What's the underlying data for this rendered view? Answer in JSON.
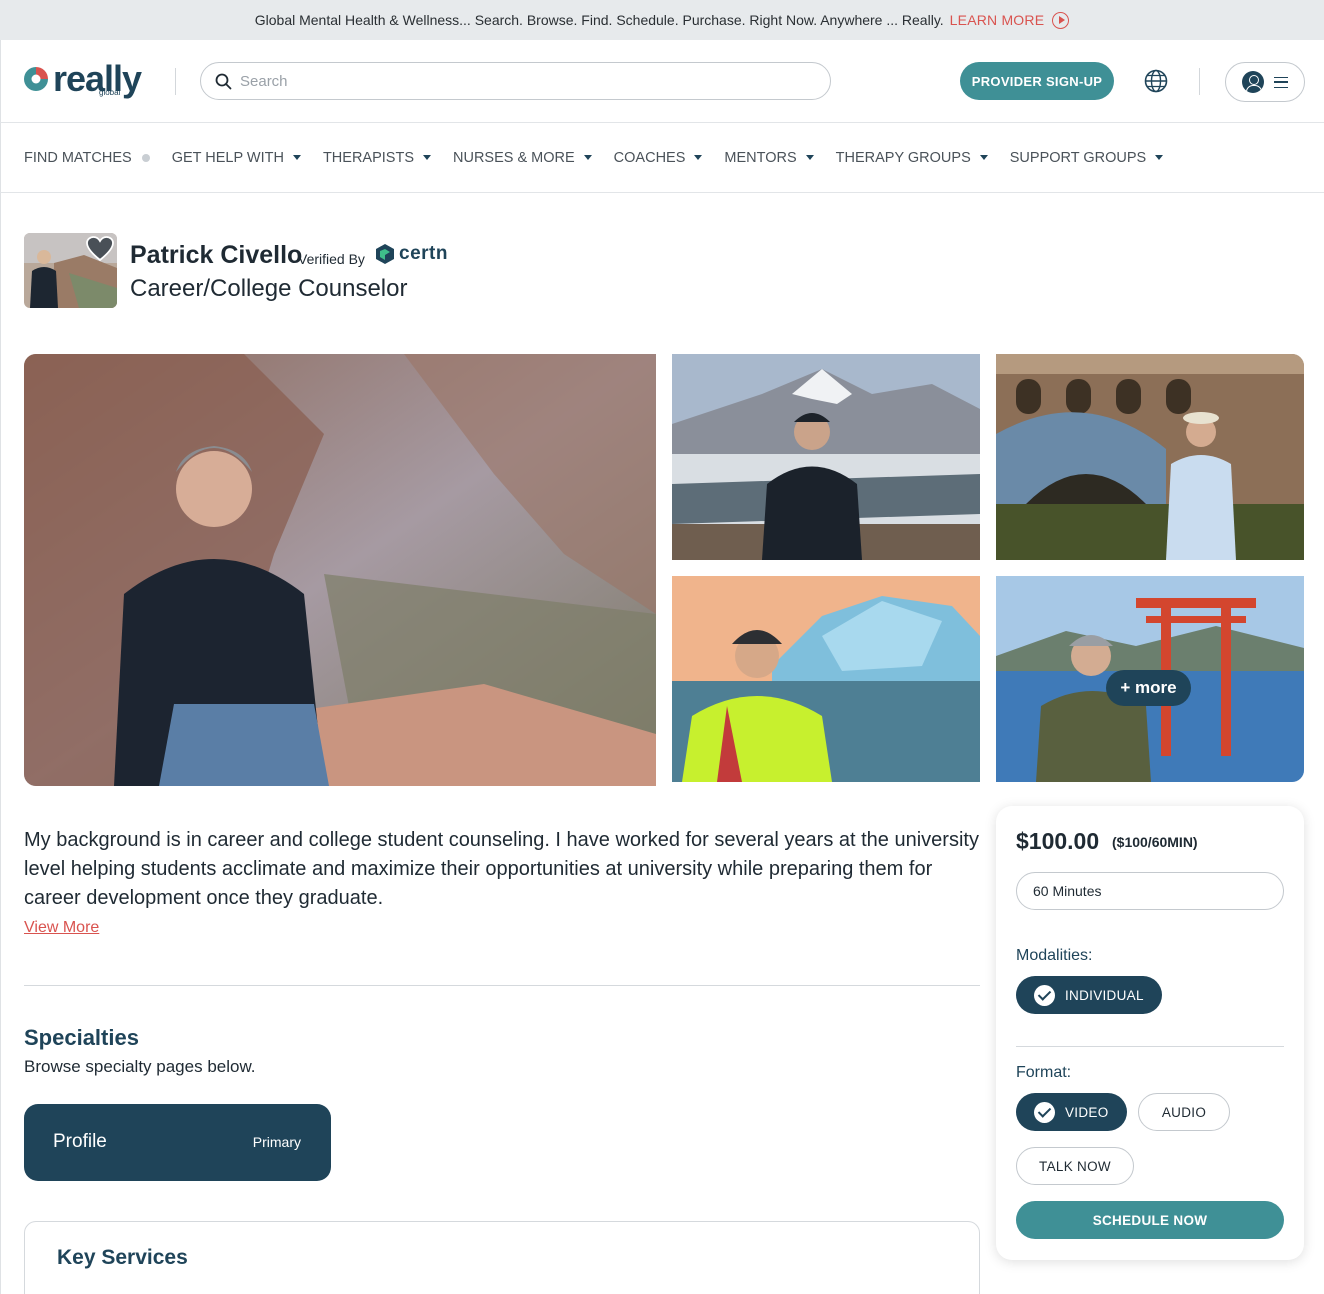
{
  "banner": {
    "text": "Global Mental Health & Wellness... Search. Browse. Find. Schedule. Purchase. Right Now. Anywhere ... Really.",
    "link": "LEARN MORE"
  },
  "header": {
    "logo_word": "really",
    "logo_sub": "global",
    "search_placeholder": "Search",
    "provider_button": "PROVIDER SIGN-UP"
  },
  "nav": [
    {
      "label": "FIND MATCHES",
      "dropdown": false
    },
    {
      "label": "GET HELP WITH",
      "dropdown": true
    },
    {
      "label": "THERAPISTS",
      "dropdown": true
    },
    {
      "label": "NURSES & MORE",
      "dropdown": true
    },
    {
      "label": "COACHES",
      "dropdown": true
    },
    {
      "label": "MENTORS",
      "dropdown": true
    },
    {
      "label": "THERAPY GROUPS",
      "dropdown": true
    },
    {
      "label": "SUPPORT GROUPS",
      "dropdown": true
    }
  ],
  "profile": {
    "name": "Patrick Civello",
    "verified_by": "Verified By",
    "verifier": "certn",
    "title": "Career/College Counselor",
    "more_photos": "+ more",
    "bio": "My background is in career and college student counseling. I have worked for several years at the university level helping students acclimate and maximize their opportunities at university while preparing them for career development once they graduate.",
    "view_more": "View More"
  },
  "specialties": {
    "heading": "Specialties",
    "subtitle": "Browse specialty pages below.",
    "card_label": "Profile",
    "card_tag": "Primary"
  },
  "key_services": {
    "heading": "Key Services"
  },
  "booking": {
    "price": "$100.00",
    "price_detail": "($100/60MIN)",
    "duration": "60 Minutes",
    "modalities_label": "Modalities:",
    "modalities": [
      {
        "label": "INDIVIDUAL",
        "selected": true
      }
    ],
    "format_label": "Format:",
    "formats": [
      {
        "label": "VIDEO",
        "selected": true
      },
      {
        "label": "AUDIO",
        "selected": false
      },
      {
        "label": "TALK NOW",
        "selected": false
      }
    ],
    "schedule_button": "SCHEDULE NOW"
  },
  "colors": {
    "brand_navy": "#1f4459",
    "brand_teal": "#3f9096",
    "accent_red": "#d9534f"
  }
}
